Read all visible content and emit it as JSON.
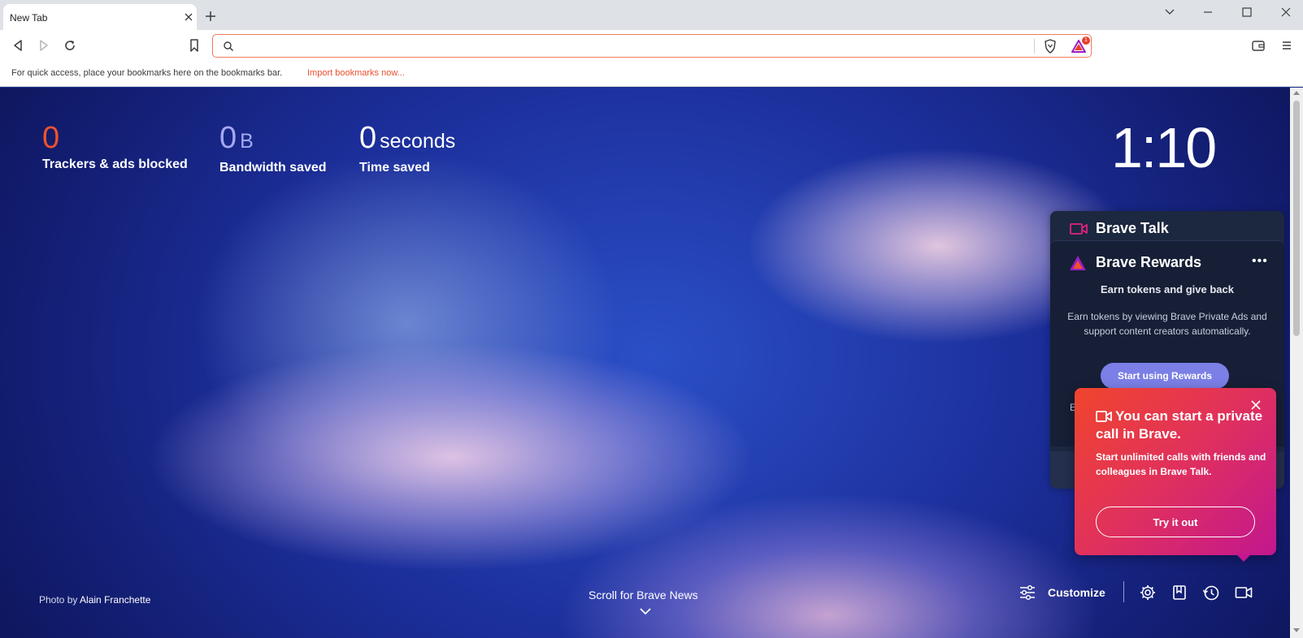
{
  "tab": {
    "title": "New Tab"
  },
  "omnibox": {
    "value": "",
    "placeholder": "",
    "rewards_badge": "1"
  },
  "bookmarks_bar": {
    "text": "For quick access, place your bookmarks here on the bookmarks bar.",
    "link": "Import bookmarks now..."
  },
  "stats": {
    "trackers": {
      "value": "0",
      "label": "Trackers & ads blocked",
      "color": "#f0522c"
    },
    "bandwidth": {
      "value": "0",
      "unit": "B",
      "label": "Bandwidth saved",
      "color": "#a5a8f2"
    },
    "time": {
      "value": "0",
      "unit": "seconds",
      "label": "Time saved",
      "color": "#ffffff"
    }
  },
  "clock": "1:10",
  "brave_talk": {
    "title": "Brave Talk"
  },
  "brave_rewards": {
    "title": "Brave Rewards",
    "more": "•••",
    "heading": "Earn tokens and give back",
    "body": "Earn tokens by viewing Brave Private Ads and support content creators automatically.",
    "button": "Start using Rewards",
    "partial_letter": "E"
  },
  "popup": {
    "title": "You can start a private call in Brave.",
    "body": "Start unlimited calls with friends and colleagues in Brave Talk.",
    "button": "Try it out"
  },
  "photo_credit": {
    "prefix": "Photo by",
    "name": "Alain Franchette"
  },
  "scroll_news": "Scroll for Brave News",
  "customize": {
    "label": "Customize"
  },
  "colors": {
    "accent": "#f0522c",
    "rewards_button": "#7b7fe6"
  }
}
